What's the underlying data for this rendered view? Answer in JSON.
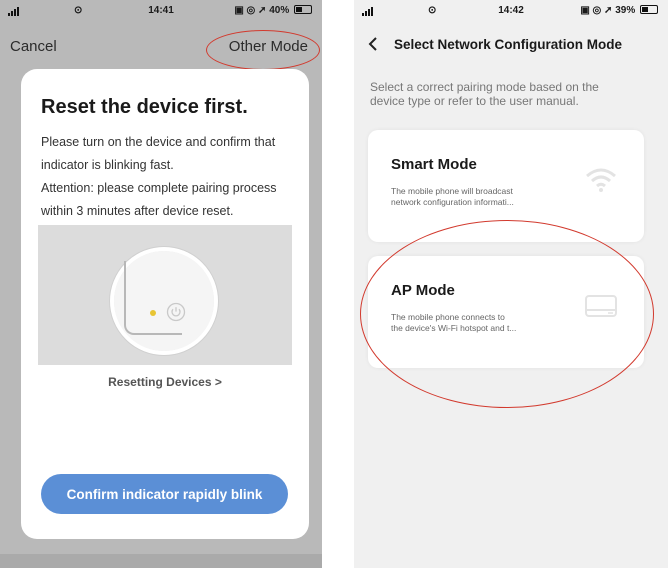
{
  "left": {
    "status": {
      "network": "",
      "time": "14:41",
      "right": "40%"
    },
    "nav": {
      "cancel": "Cancel",
      "other_mode": "Other Mode"
    },
    "card": {
      "title": "Reset the device first.",
      "desc_lines": [
        "Please turn on the device and confirm that",
        "indicator is blinking fast.",
        "Attention: please complete pairing process",
        "within 3 minutes after device reset."
      ],
      "resetting_link": "Resetting Devices >",
      "confirm_button": "Confirm indicator rapidly blink"
    }
  },
  "right": {
    "status": {
      "time": "14:42",
      "right": "39%"
    },
    "nav": {
      "title": "Select Network Configuration Mode"
    },
    "hint_lines": [
      "Select a correct pairing mode based on the",
      "device type or refer to the user manual."
    ],
    "modes": [
      {
        "title": "Smart Mode",
        "desc_lines": [
          "The mobile phone will broadcast",
          "network configuration informati..."
        ],
        "icon": "wifi-icon"
      },
      {
        "title": "AP Mode",
        "desc_lines": [
          "The mobile phone connects to",
          "the device's Wi-Fi hotspot and t..."
        ],
        "icon": "router-icon"
      }
    ]
  },
  "colors": {
    "annotation_red": "#d23a2e",
    "confirm_button": "#5b8fd6",
    "indicator_led": "#e8c534"
  }
}
